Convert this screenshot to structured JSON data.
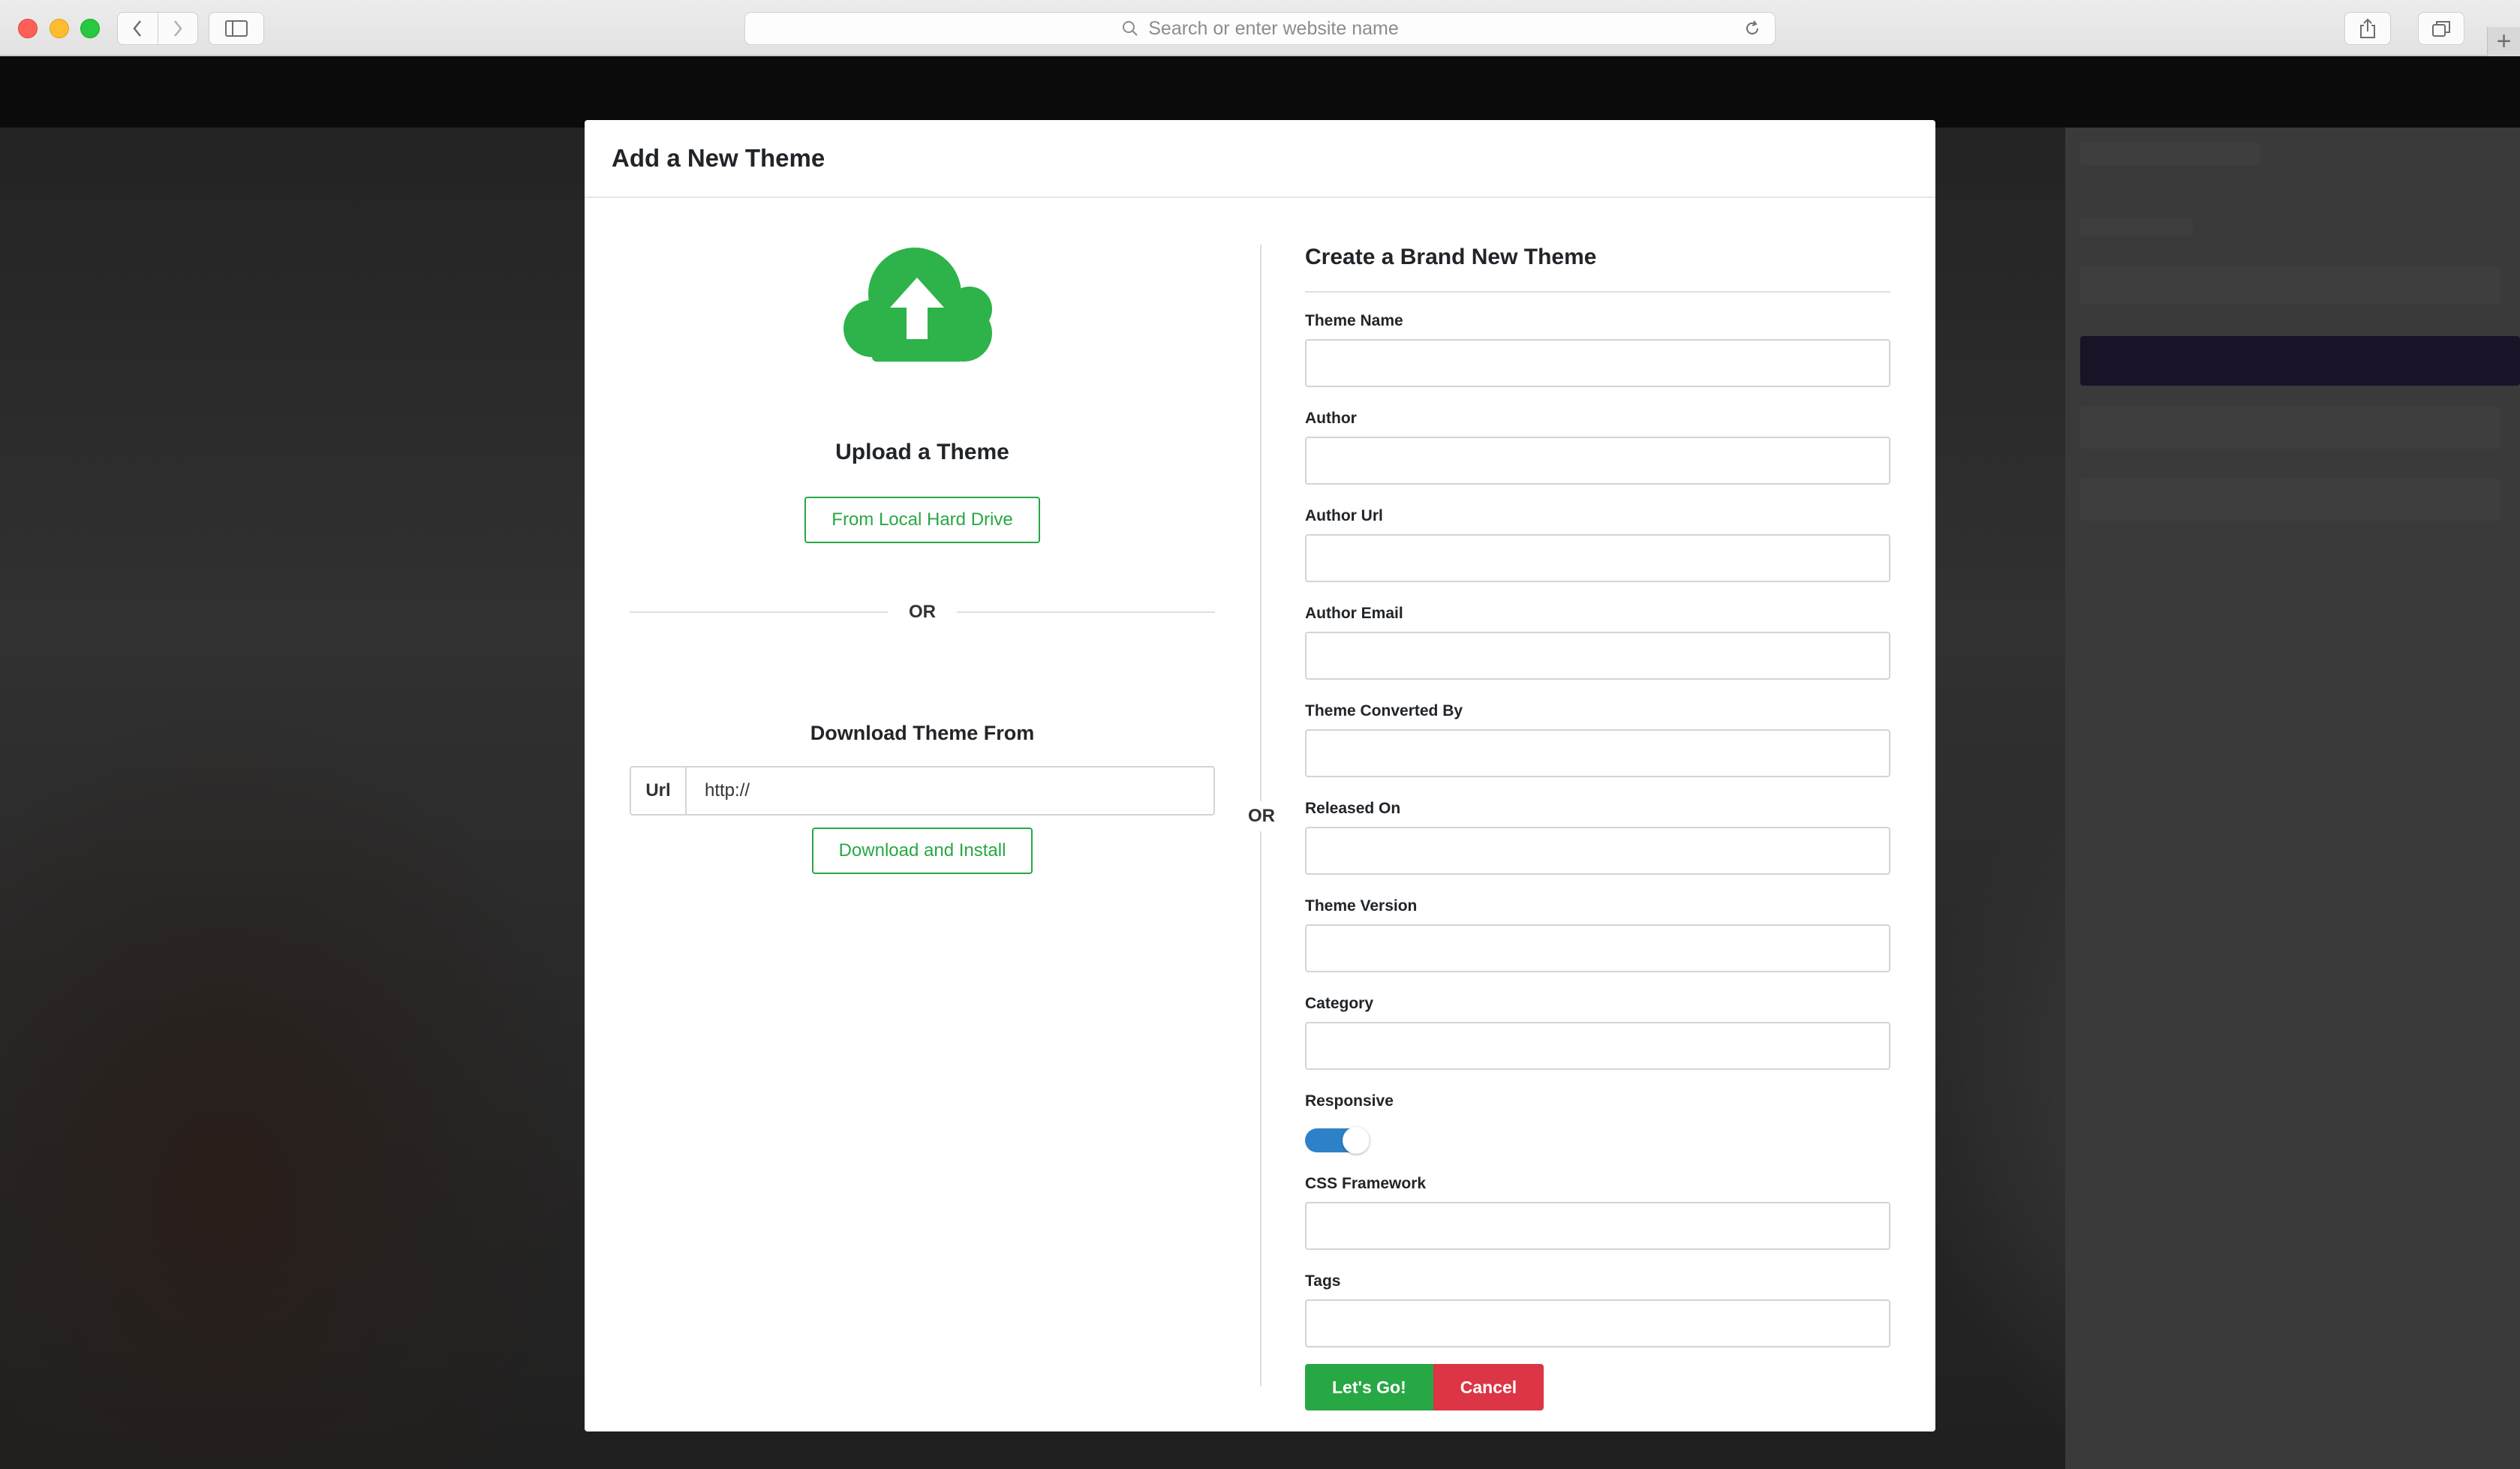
{
  "browser": {
    "address_placeholder": "Search or enter website name"
  },
  "modal": {
    "title": "Add a New Theme",
    "divider_or": "OR"
  },
  "upload": {
    "title": "Upload a Theme",
    "local_button": "From Local Hard Drive",
    "or_label": "OR",
    "download_title": "Download Theme From",
    "url_addon": "Url",
    "url_value": "http://",
    "download_button": "Download and Install",
    "icon_color": "#2db34a"
  },
  "create": {
    "title": "Create a Brand New Theme",
    "fields": {
      "theme_name": {
        "label": "Theme Name",
        "value": ""
      },
      "author": {
        "label": "Author",
        "value": ""
      },
      "author_url": {
        "label": "Author Url",
        "value": ""
      },
      "author_email": {
        "label": "Author Email",
        "value": ""
      },
      "converted_by": {
        "label": "Theme Converted By",
        "value": ""
      },
      "released_on": {
        "label": "Released On",
        "value": ""
      },
      "version": {
        "label": "Theme Version",
        "value": ""
      },
      "category": {
        "label": "Category",
        "value": ""
      },
      "responsive": {
        "label": "Responsive",
        "on": true
      },
      "css_framework": {
        "label": "CSS Framework",
        "value": ""
      },
      "tags": {
        "label": "Tags",
        "value": ""
      }
    },
    "submit_button": "Let's Go!",
    "cancel_button": "Cancel"
  },
  "colors": {
    "success": "#28a745",
    "danger": "#dc3545",
    "toggle_on": "#2d82c7"
  }
}
